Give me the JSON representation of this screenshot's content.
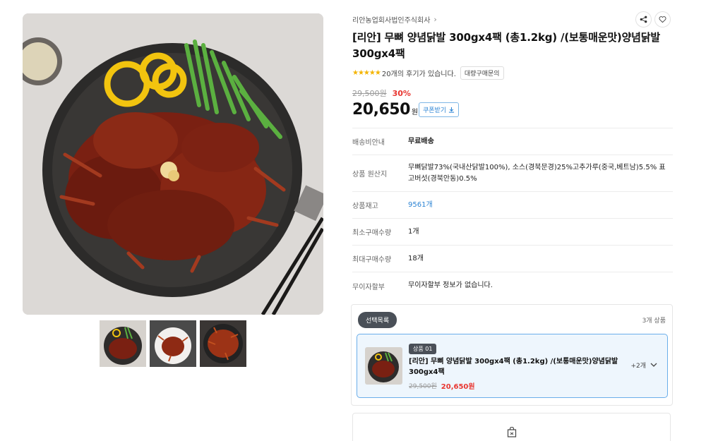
{
  "product": {
    "brand": "리안농업회사법인주식회사",
    "title": "[리안] 무뼈 양념닭발 300gx4팩 (총1.2kg) /(보통매운맛)양념닭발 300gx4팩",
    "rating_stars": "★★★★★",
    "review_text": "20개의 후기가 있습니다.",
    "bulk_inquiry_label": "대량구매문의",
    "original_price": "29,500원",
    "discount_rate": "30%",
    "sale_price": "20,650",
    "currency_unit": "원",
    "coupon_label": "쿠폰받기"
  },
  "icons": {
    "share": "share-icon",
    "wishlist": "heart-icon",
    "brand_chevron": "chevron-right-icon",
    "coupon_download": "download-icon",
    "option_toggle": "chevron-down-icon",
    "cart": "shopping-bag-icon"
  },
  "specs": [
    {
      "label": "배송비안내",
      "value": "무료배송"
    },
    {
      "label": "상품 원산지",
      "value": "무뼈닭발73%(국내산닭발100%), 소스(경북문경)25%고추가루(중국,베트남)5.5% 표고버섯(경북안동)0.5%"
    },
    {
      "label": "상품재고",
      "value": "9561개"
    },
    {
      "label": "최소구매수량",
      "value": "1개"
    },
    {
      "label": "최대구매수량",
      "value": "18개"
    },
    {
      "label": "무이자할부",
      "value": "무이자할부 정보가 없습니다."
    }
  ],
  "selection": {
    "tag": "선택목록",
    "count": "3개 상품",
    "item": {
      "badge": "상품 01",
      "name": "[리안] 무뼈 양념닭발 300gx4팩 (총1.2kg) /(보통매운맛)양념닭발 300gx4팩",
      "original_price": "29,500원",
      "sale_price": "20,650원",
      "more_label": "+2개"
    }
  },
  "colors": {
    "discount_red": "#e8352f",
    "link_blue": "#2c84d4",
    "selected_border": "#6aaeea",
    "star_yellow": "#f4b400"
  }
}
